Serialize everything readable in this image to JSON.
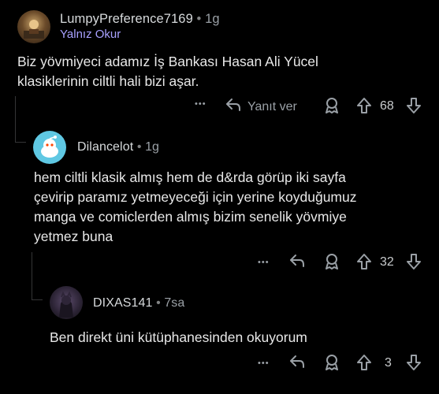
{
  "comments": [
    {
      "username": "LumpyPreference7169",
      "separator": "•",
      "time": "1g",
      "flair": "Yalnız Okur",
      "text": "Biz yövmiyeci adamız İş Bankası Hasan Ali Yücel\nklasiklerinin ciltli hali bizi aşar.",
      "reply_label": "Yanıt ver",
      "more": "•••",
      "votes": "68"
    },
    {
      "username": "Dilancelot",
      "separator": "•",
      "time": "1g",
      "text": "hem ciltli klasik almış hem de d&rda görüp iki sayfa\nçevirip paramız yetmeyeceği için yerine koyduğumuz\nmanga ve comiclerden almış bizim senelik yövmiye\nyetmez buna",
      "more": "•••",
      "votes": "32"
    },
    {
      "username": "DIXAS141",
      "separator": "•",
      "time": "7sa",
      "text": "Ben direkt üni kütüphanesinden okuyorum",
      "more": "•••",
      "votes": "3"
    }
  ],
  "icons": [
    "reply-icon",
    "award-icon",
    "upvote-icon",
    "downvote-icon",
    "more-icon"
  ],
  "colors": {
    "background": "#000000",
    "flair": "#a8a1ff",
    "thread_line": "#343536",
    "text": "#d7dadc"
  }
}
